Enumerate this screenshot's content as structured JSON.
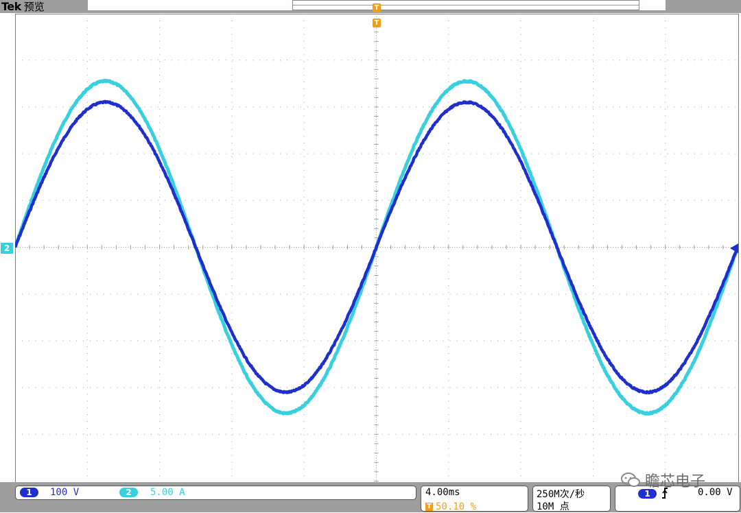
{
  "header": {
    "brand": "Tek",
    "mode": "预览"
  },
  "markers": {
    "channel2": "2",
    "trigger": "T"
  },
  "status": {
    "ch1": {
      "badge": "1",
      "scale": "100 V",
      "color": "#1f2fcc"
    },
    "ch2": {
      "badge": "2",
      "scale": "5.00 A",
      "color": "#38d0df"
    },
    "timebase": {
      "scale": "4.00ms",
      "trigger_badge": "T",
      "trigger_position": "50.10 %"
    },
    "acquisition": {
      "sample_rate": "250M次/秒",
      "record_length": "10M 点"
    },
    "trigger": {
      "source_badge": "1",
      "slope_icon": "rising-edge-icon",
      "level": "0.00 V"
    }
  },
  "watermark": {
    "text": "瞻芯电子",
    "icon": "wechat-icon"
  },
  "colors": {
    "ch1": "#1f2fcc",
    "ch2": "#38d0df",
    "trigger": "#f29f16",
    "frame": "#9e9e9e"
  },
  "chart_data": {
    "type": "line",
    "grid": "10x10 divisions",
    "time_per_division_ms": 4,
    "series": [
      {
        "name": "1",
        "unit": "V",
        "volts_per_division": 100,
        "peak_divisions": 3.1,
        "frequency_hz": 50,
        "phase": "zero-crossing rising at screen left"
      },
      {
        "name": "2",
        "unit": "A",
        "amps_per_division": 5,
        "peak_divisions": 3.55,
        "frequency_hz": 50,
        "phase": "in phase with channel 1"
      }
    ]
  }
}
